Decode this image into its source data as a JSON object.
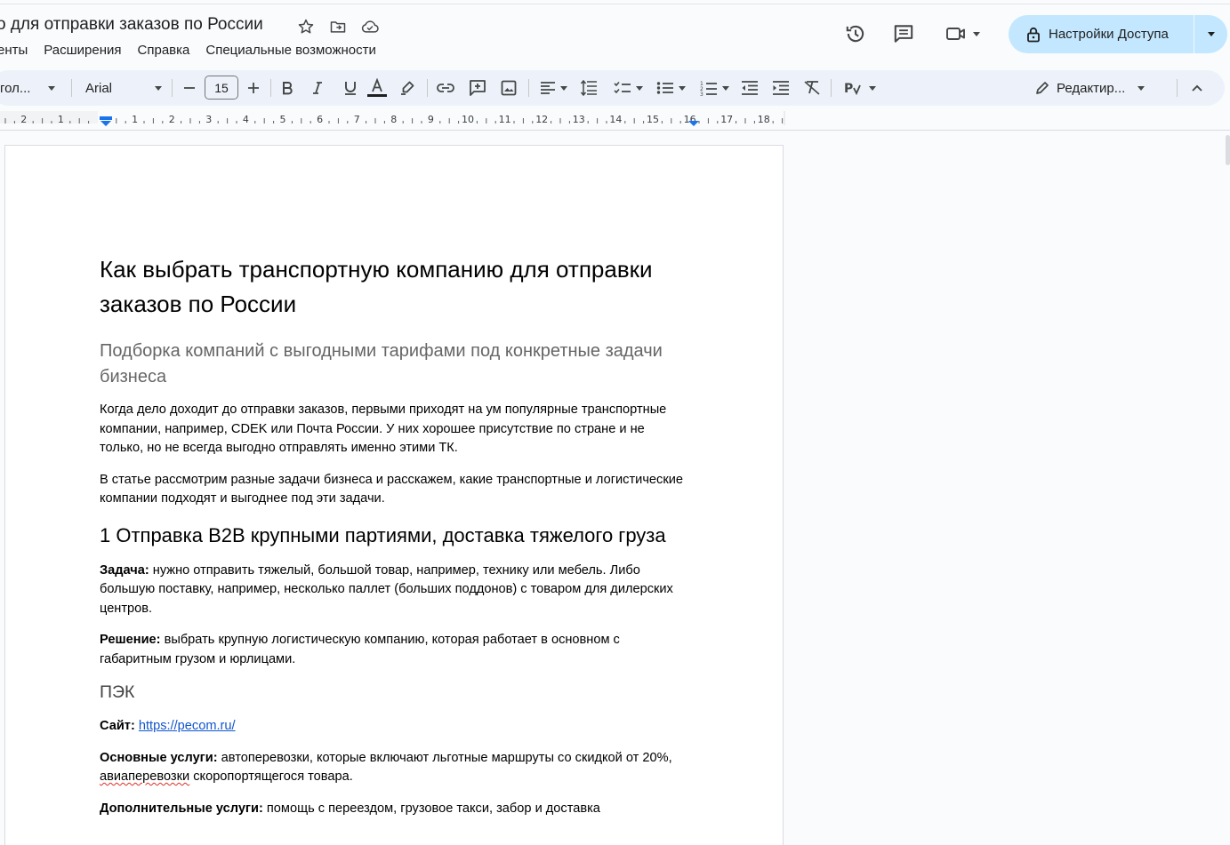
{
  "titlebar": {
    "doc_title": "о для отправки заказов по России",
    "icons": [
      "star-icon",
      "move-to-folder-icon",
      "cloud-saved-icon"
    ]
  },
  "menu": [
    "енты",
    "Расширения",
    "Справка",
    "Специальные возможности"
  ],
  "actions": {
    "history_icon": "history-icon",
    "comments_icon": "comments-icon",
    "meet_icon": "videocam-icon",
    "share_label": "Настройки Доступа"
  },
  "toolbar": {
    "style_value": "гол...",
    "font_value": "Arial",
    "font_size": "15",
    "mode_label": "Редактир..."
  },
  "ruler": {
    "labels": [
      "2",
      "1",
      "1",
      "2",
      "3",
      "4",
      "5",
      "6",
      "7",
      "8",
      "9",
      "10",
      "11",
      "12",
      "13",
      "14",
      "15",
      "16",
      "17",
      "18"
    ]
  },
  "document": {
    "title": "Как выбрать транспортную компанию для отправки заказов по России",
    "subtitle": "Подборка компаний с выгодными тарифами под конкретные задачи бизнеса",
    "intro1": "Когда дело доходит до отправки заказов, первыми приходят на ум популярные транспортные компании, например, CDEK или Почта России. У них хорошее присутствие по стране и не только, но не всегда выгодно отправлять именно этими ТК.",
    "intro2": "В статье рассмотрим разные задачи бизнеса и расскажем, какие транспортные и логистические компании подходят и выгоднее под эти задачи.",
    "section1_heading": "1 Отправка B2B крупными партиями, доставка тяжелого груза",
    "task_label": "Задача:",
    "task_text": " нужно отправить тяжелый, большой товар, например, технику или мебель. Либо большую поставку, например, несколько паллет (больших поддонов) с товаром для дилерских центров.",
    "solution_label": "Решение:",
    "solution_text": " выбрать крупную логистическую компанию, которая работает в основном с габаритным грузом и юрлицами.",
    "company_heading": "ПЭК",
    "site_label": "Сайт:",
    "site_link": "https://pecom.ru/",
    "services_label": "Основные услуги:",
    "services_text_1": " автоперевозки, которые включают льготные маршруты со скидкой от 20%, ",
    "services_misspelled": "авиаперевозки",
    "services_text_2": " скоропортящегося товара.",
    "extra_label": "Дополнительные услуги:",
    "extra_text": " помощь с переездом, грузовое такси, забор и доставка"
  }
}
